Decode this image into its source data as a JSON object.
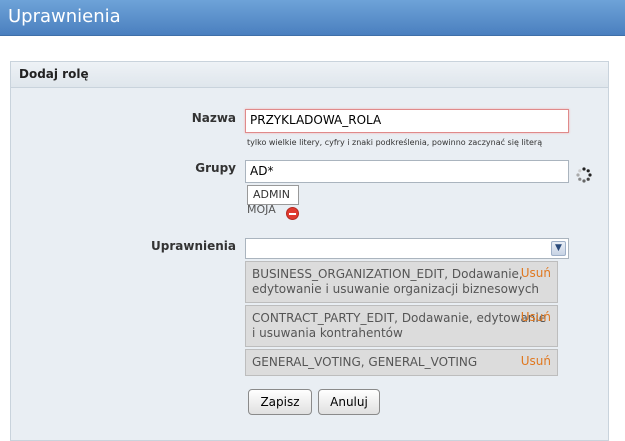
{
  "header": {
    "title": "Uprawnienia"
  },
  "panel": {
    "title": "Dodaj rolę"
  },
  "form": {
    "name_label": "Nazwa",
    "name_value": "PRZYKLADOWA_ROLA",
    "name_hint": "tylko wielkie litery, cyfry i znaki podkreślenia, powinno zaczynać się literą",
    "groups_label": "Grupy",
    "groups_value": "AD*",
    "groups_suggestion": "ADMIN",
    "groups_selected": "MOJA",
    "permissions_label": "Uprawnienia",
    "permissions_select_value": "",
    "permissions": [
      {
        "text": "BUSINESS_ORGANIZATION_EDIT, Dodawanie, edytowanie i usuwanie organizacji biznesowych",
        "remove": "Usuń"
      },
      {
        "text": "CONTRACT_PARTY_EDIT, Dodawanie, edytowanie i usuwania kontrahentów",
        "remove": "Usuń"
      },
      {
        "text": "GENERAL_VOTING, GENERAL_VOTING",
        "remove": "Usuń"
      }
    ],
    "save_label": "Zapisz",
    "cancel_label": "Anuluj"
  },
  "colors": {
    "header_bg": "#5a8fcb",
    "panel_bg": "#e9eef3",
    "remove_link": "#e07820",
    "invalid_border": "#e8a0a0"
  }
}
